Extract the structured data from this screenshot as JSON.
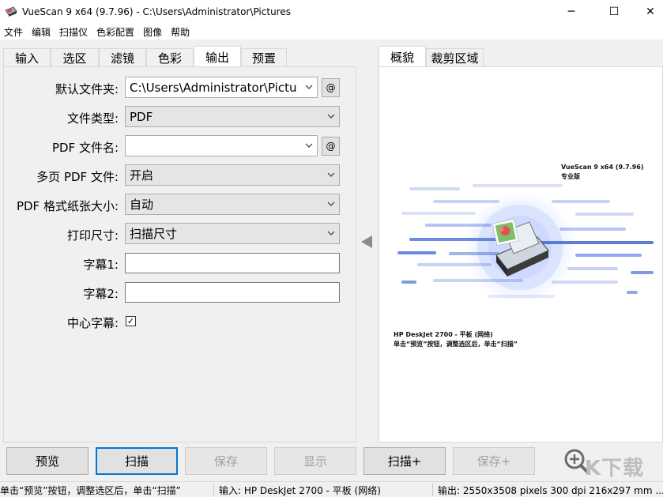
{
  "window": {
    "title": "VueScan 9 x64 (9.7.96) - C:\\Users\\Administrator\\Pictures",
    "minimize_glyph": "─",
    "maximize_glyph": "☐",
    "close_glyph": "✕"
  },
  "menu": [
    "文件",
    "编辑",
    "扫描仪",
    "色彩配置",
    "图像",
    "帮助"
  ],
  "left_tabs": [
    {
      "label": "输入",
      "active": false
    },
    {
      "label": "选区",
      "active": false
    },
    {
      "label": "滤镜",
      "active": false
    },
    {
      "label": "色彩",
      "active": false
    },
    {
      "label": "输出",
      "active": true
    },
    {
      "label": "预置",
      "active": false
    }
  ],
  "output_form": {
    "default_folder": {
      "label": "默认文件夹:",
      "value": "C:\\Users\\Administrator\\Pictu",
      "at_label": "@"
    },
    "file_type": {
      "label": "文件类型:",
      "value": "PDF"
    },
    "pdf_filename": {
      "label": "PDF 文件名:",
      "value": "",
      "at_label": "@"
    },
    "multipage_pdf": {
      "label": "多页 PDF 文件:",
      "value": "开启"
    },
    "pdf_paper_size": {
      "label": "PDF 格式纸张大小:",
      "value": "自动"
    },
    "print_size": {
      "label": "打印尺寸:",
      "value": "扫描尺寸"
    },
    "caption1": {
      "label": "字幕1:",
      "value": ""
    },
    "caption2": {
      "label": "字幕2:",
      "value": ""
    },
    "center_caption": {
      "label": "中心字幕:",
      "checked": true,
      "check_glyph": "✓"
    }
  },
  "right_tabs": [
    {
      "label": "概貌",
      "active": true
    },
    {
      "label": "裁剪区域",
      "active": false
    }
  ],
  "preview": {
    "product": "VueScan 9 x64 (9.7.96)",
    "edition": "专业版",
    "device": "HP DeskJet 2700 - 平板 (网络)",
    "hint": "单击“预览”按钮，调整选区后，单击“扫描”"
  },
  "buttons": {
    "preview": "预览",
    "scan": "扫描",
    "save": "保存",
    "show": "显示",
    "scan_plus": "扫描+",
    "save_plus": "保存+"
  },
  "watermark": "K下载",
  "status": {
    "left": "单击“预览”按钮，调整选区后，单击“扫描”",
    "input": "输入: HP DeskJet 2700 - 平板 (网络)",
    "output": "输出: 2550x3508 pixels 300 dpi 216x297 mm ..."
  },
  "colors": {
    "accent": "#0078d7",
    "preview_blue": "#4a6fd8",
    "disabled_text": "#a0a0a0"
  },
  "icons": [
    "vuescan-app-icon",
    "chevron-down-icon",
    "zoom-in-icon",
    "collapse-arrow-icon"
  ]
}
